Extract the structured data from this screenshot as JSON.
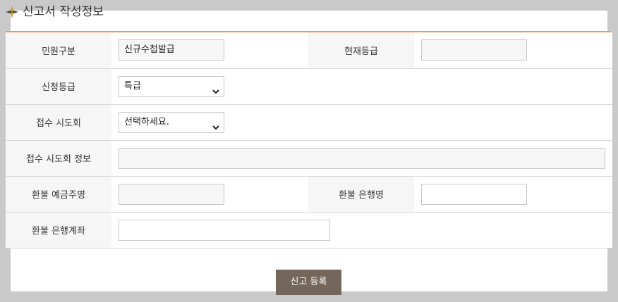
{
  "section": {
    "title": "신고서 작성정보",
    "icon": "compass-star-icon"
  },
  "colors": {
    "accent": "#e89a5e",
    "button_bg": "#74665a",
    "icon_gold": "#c9a227",
    "icon_dark": "#4a3f35"
  },
  "form": {
    "civil_type": {
      "label": "민원구분",
      "value": "신규수첩발급"
    },
    "current_grade": {
      "label": "현재등급",
      "value": ""
    },
    "apply_grade": {
      "label": "신청등급",
      "selected": "특급"
    },
    "reception_city": {
      "label": "접수 시도회",
      "selected": "선택하세요."
    },
    "reception_info": {
      "label": "접수 시도회 정보",
      "value": ""
    },
    "refund_holder": {
      "label": "환불 예금주명",
      "value": ""
    },
    "refund_bank": {
      "label": "환불 은행명",
      "value": ""
    },
    "refund_account": {
      "label": "환불 은행계좌",
      "value": ""
    }
  },
  "actions": {
    "submit_label": "신고 등록"
  }
}
